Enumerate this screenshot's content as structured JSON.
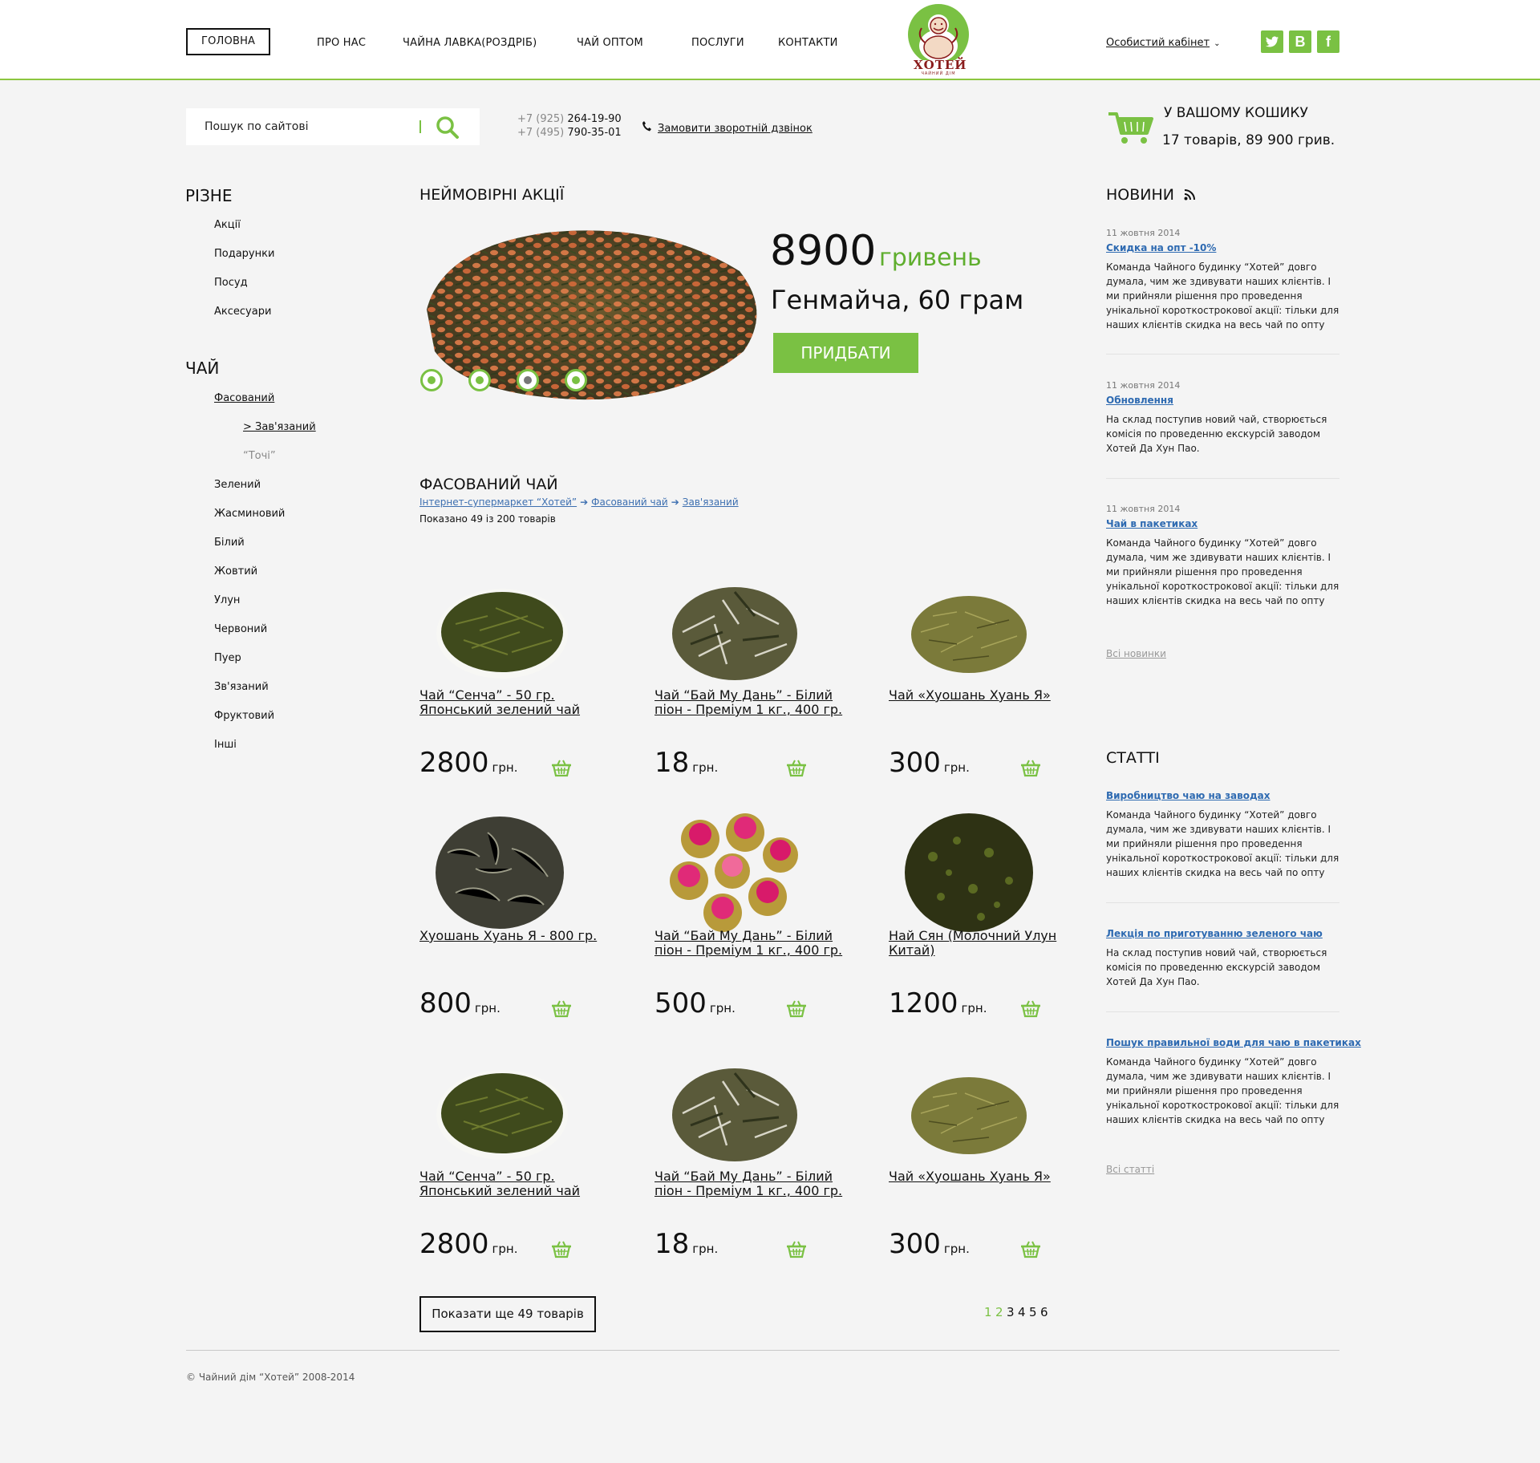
{
  "nav": {
    "items": [
      "ГОЛОВНА",
      "ПРО НАС",
      "ЧАЙНА ЛАВКА(РОЗДРІБ)",
      "ЧАЙ ОПТОМ",
      "ПОСЛУГИ",
      "КОНТАКТИ"
    ],
    "cabinet": "Особистий кабінет",
    "social": [
      "twitter-icon",
      "vk-icon",
      "facebook-icon"
    ]
  },
  "logo": {
    "text": "ХОТЕЙ",
    "subtitle": "ЧАЙНИЙ ДІМ"
  },
  "search": {
    "placeholder": "Пошук по сайтові"
  },
  "phones": [
    {
      "code": "+7 (925)",
      "number": "264-19-90"
    },
    {
      "code": "+7 (495)",
      "number": "790-35-01"
    }
  ],
  "callback": "Замовити зворотній дзвінок",
  "cart": {
    "title": "У ВАШОМУ КОШИКУ",
    "summary": "17 товарів, 89 900 грив."
  },
  "sidebar": {
    "misc_title": "РІЗНЕ",
    "misc": [
      "Акції",
      "Подарунки",
      "Посуд",
      "Аксесуари"
    ],
    "tea_title": "ЧАЙ",
    "tea_current": "Фасований",
    "tea_sub_current": "> Зав'язаний",
    "tea_sub_other": "“Точі”",
    "tea": [
      "Зелений",
      "Жасминовий",
      "Білий",
      "Жовтий",
      "Улун",
      "Червоний",
      "Пуер",
      "Зв'язаний",
      "Фруктовий",
      "Інші"
    ]
  },
  "promo": {
    "title": "НЕЙМОВІРНІ АКЦІЇ",
    "price": "8900",
    "currency": "гривень",
    "name": "Генмайча, 60 грам",
    "buy": "ПРИДБАТИ",
    "slides": 4,
    "current_slide": 3
  },
  "catalog": {
    "title": "ФАСОВАНИЙ ЧАЙ",
    "breadcrumb": [
      "Інтернет-супермаркет “Хотей”",
      "Фасований чай",
      "Зав'язаний"
    ],
    "shown": "Показано 49 із 200 товарів",
    "currency": "грн.",
    "products": [
      {
        "name": "Чай “Сенча” - 50 гр. Японський зелений чай",
        "price": "2800",
        "image": "sencha-tea"
      },
      {
        "name": "Чай  “Бай Му Дань” - Білий піон - Преміум 1 кг., 400 гр.",
        "price": "18",
        "image": "white-peony-tea"
      },
      {
        "name": "Чай «Хуошань Хуань Я»",
        "price": "300",
        "image": "huoshan-tea"
      },
      {
        "name": "Хуошань Хуань Я - 800 гр.",
        "price": "800",
        "image": "huoshan-loose-tea"
      },
      {
        "name": "Чай  “Бай Му Дань” - Білий піон - Преміум 1 кг., 400 гр.",
        "price": "500",
        "image": "flowering-tea"
      },
      {
        "name": "Най Сян (Молочний Улун Китай)",
        "price": "1200",
        "image": "milk-oolong-tea"
      },
      {
        "name": "Чай “Сенча” - 50 гр. Японський зелений чай",
        "price": "2800",
        "image": "sencha-tea"
      },
      {
        "name": "Чай  “Бай Му Дань” - Білий піон - Преміум 1 кг., 400 гр.",
        "price": "18",
        "image": "white-peony-tea"
      },
      {
        "name": "Чай «Хуошань Хуань Я»",
        "price": "300",
        "image": "huoshan-tea"
      }
    ],
    "more": "Показати ще 49 товарів",
    "pages": [
      "1",
      "2",
      "3",
      "4",
      "5",
      "6"
    ],
    "active_pages": [
      "1",
      "2"
    ]
  },
  "news": {
    "title": "НОВИНИ",
    "items": [
      {
        "date": "11 жовтня 2014",
        "title": "Скидка на опт -10%",
        "text": "Команда Чайного будинку “Хотей” довго думала, чим же здивувати наших клієнтів. І ми прийняли рішення про проведення унікальної короткострокової акції: тільки для наших клієнтів скидка на весь чай по опту"
      },
      {
        "date": "11 жовтня 2014",
        "title": "Обновлення",
        "text": "На склад поступив новий чай, створюється комісія по проведенню екскурсій заводом Хотей Да Хун Пао."
      },
      {
        "date": "11 жовтня 2014",
        "title": "Чай в пакетиках",
        "text": "Команда Чайного будинку “Хотей” довго думала, чим же здивувати наших клієнтів. І ми прийняли рішення про проведення унікальної короткострокової акції: тільки для наших клієнтів скидка на весь чай по опту"
      }
    ],
    "all": "Всі новинки"
  },
  "articles": {
    "title": "СТАТТІ",
    "items": [
      {
        "title": "Виробництво чаю на заводах",
        "text": "Команда Чайного будинку “Хотей” довго думала, чим же здивувати наших клієнтів. І ми прийняли рішення про проведення унікальної короткострокової акції: тільки для наших клієнтів скидка на весь чай по опту"
      },
      {
        "title": "Лекція по приготуванню зеленого чаю",
        "text": "На склад поступив новий чай, створюється комісія по проведенню екскурсій заводом Хотей Да Хун Пао."
      },
      {
        "title": "Пошук правильної води для чаю в пакетиках",
        "text": "Команда Чайного будинку “Хотей” довго думала, чим же здивувати наших клієнтів. І ми прийняли рішення про проведення унікальної короткострокової акції: тільки для наших клієнтів скидка на весь чай по опту"
      }
    ],
    "all": "Всі статті"
  },
  "footer": {
    "copyright": "© Чайний дім “Хотей” 2008-2014"
  },
  "colors": {
    "accent": "#7ac143",
    "link": "#2e6ab1",
    "promo_currency": "#5fae2e"
  }
}
